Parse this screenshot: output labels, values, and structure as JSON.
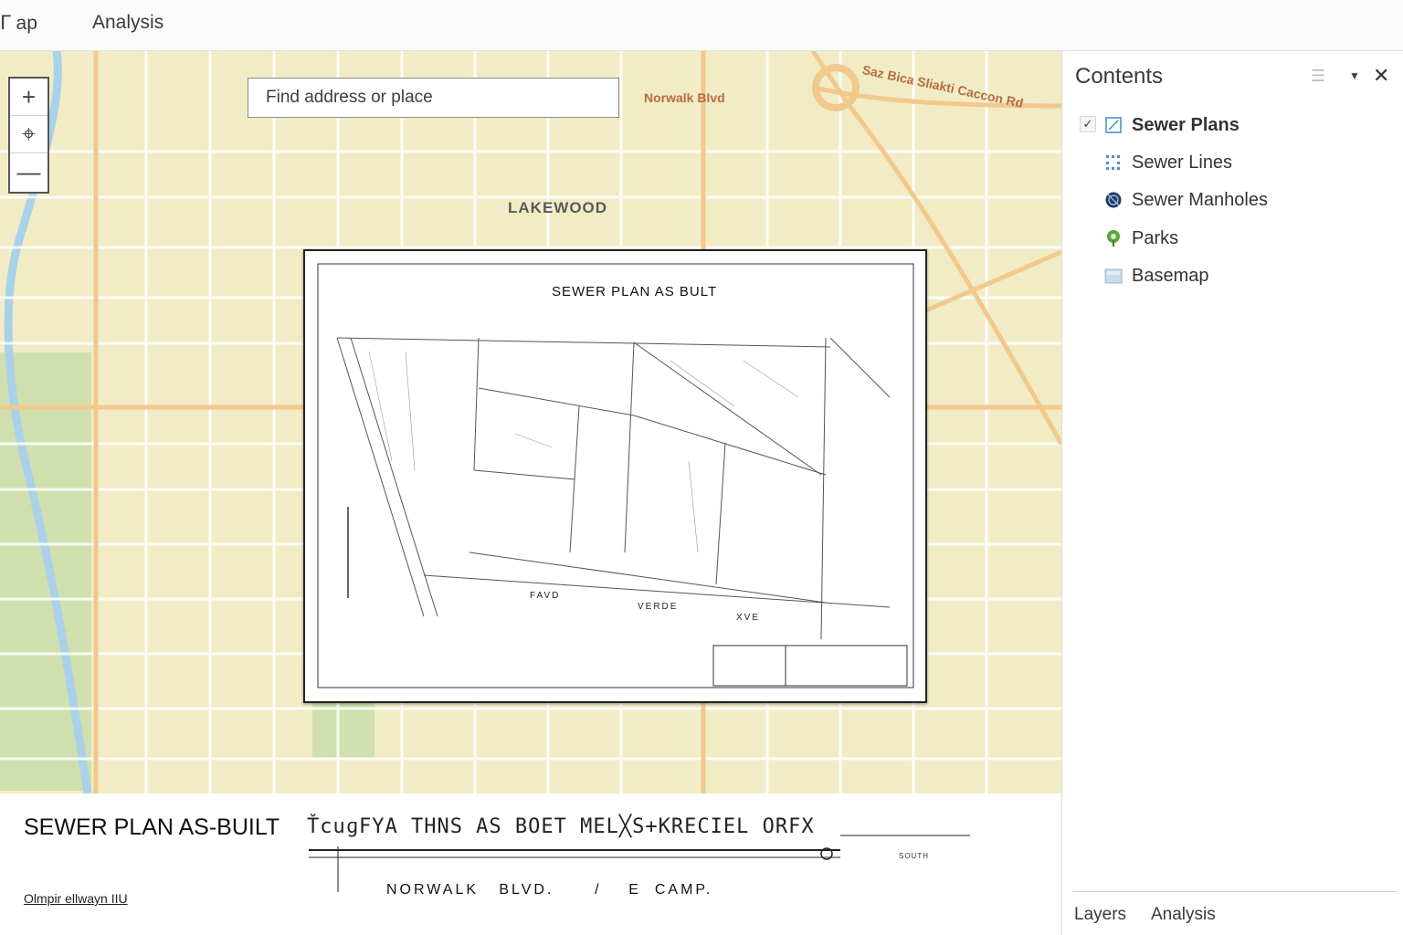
{
  "topbar": {
    "tabs": [
      {
        "label": "ᒥ ap"
      },
      {
        "label": "Analysis"
      }
    ]
  },
  "map": {
    "search_placeholder": "Find address or place",
    "zoom": {
      "in": "+",
      "home": "⌖",
      "out": "—"
    },
    "labels": {
      "city": "LAKEWOOD",
      "road1": "Norwalk Blvd",
      "road2": "Saz Bica Sliakti Caccon Rd"
    }
  },
  "plan": {
    "title": "SEWER PLAN AS BULT",
    "streets": [
      "FAVD",
      "VERDE",
      "XVE"
    ]
  },
  "strip": {
    "title": "SEWER PLAN AS-BUILT",
    "scan_text": "ŤcuɡFYA THNS AS BOET  MEL╳S+KRECIEL ORFX",
    "streets": "NORWALK   BLVD.      /    E  CAMP.",
    "south": "SOUTH",
    "logo": "Olmpir ellwayn IIU"
  },
  "panel": {
    "title": "Contents",
    "layers": [
      {
        "name": "Sewer Plans",
        "icon": "sewer-plans-icon"
      },
      {
        "name": "Sewer Lines",
        "icon": "sewer-lines-icon"
      },
      {
        "name": "Sewer Manholes",
        "icon": "sewer-manholes-icon"
      },
      {
        "name": "Parks",
        "icon": "parks-icon"
      },
      {
        "name": "Basemap",
        "icon": "basemap-icon"
      }
    ],
    "footer_tabs": [
      {
        "label": "Layers"
      },
      {
        "label": "Analysis"
      }
    ]
  },
  "colors": {
    "map_bg": "#f1ecc6",
    "road": "#f2c98c",
    "park": "#cfe0ae",
    "water": "#a9d1e9",
    "road_label": "#b66d40"
  }
}
